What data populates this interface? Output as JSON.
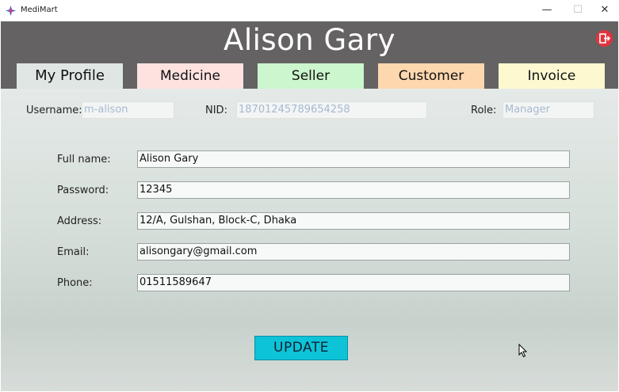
{
  "window": {
    "title": "MediMart",
    "minimize_glyph": "—",
    "maximize_glyph": "☐",
    "close_glyph": "✕"
  },
  "header": {
    "user_name": "Alison Gary",
    "logout_icon": "logout-icon",
    "accent_color": "#e2343d"
  },
  "tabs": [
    {
      "label": "My Profile",
      "color": "#dfe6e3",
      "active": true
    },
    {
      "label": "Medicine",
      "color": "#fde2e0",
      "active": false
    },
    {
      "label": "Seller",
      "color": "#ccf6cd",
      "active": false
    },
    {
      "label": "Customer",
      "color": "#fdd7ae",
      "active": false
    },
    {
      "label": "Invoice",
      "color": "#fdf8d0",
      "active": false
    }
  ],
  "info": {
    "username_label": "Username:",
    "username_value": "m-alison",
    "nid_label": "NID:",
    "nid_value": "18701245789654258",
    "role_label": "Role:",
    "role_value": "Manager"
  },
  "form": {
    "fullname_label": "Full name:",
    "fullname_value": "Alison Gary",
    "password_label": "Password:",
    "password_value": "12345",
    "address_label": "Address:",
    "address_value": "12/A, Gulshan, Block-C, Dhaka",
    "email_label": "Email:",
    "email_value": "alisongary@gmail.com",
    "phone_label": "Phone:",
    "phone_value": "01511589647"
  },
  "update_button": {
    "label": "UPDATE",
    "color": "#0dc3d8"
  }
}
